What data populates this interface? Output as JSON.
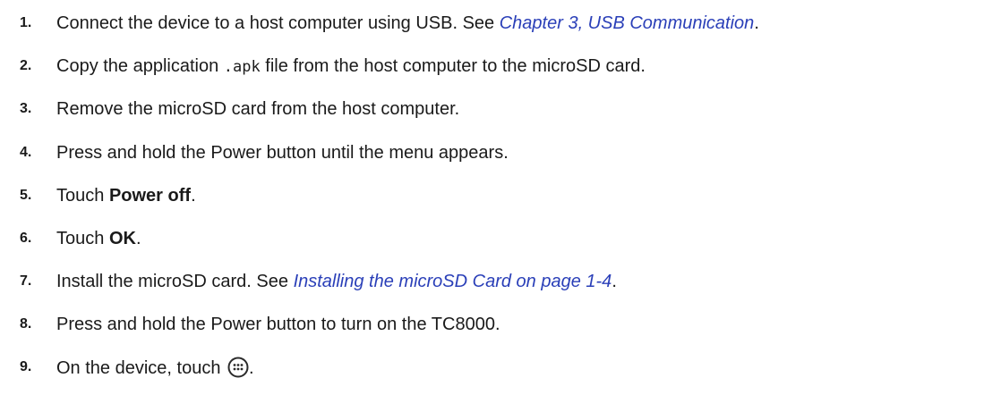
{
  "steps": [
    {
      "number": "1.",
      "text_before": "Connect the device to a host computer using USB. See ",
      "link": "Chapter 3, USB Communication",
      "text_after": "."
    },
    {
      "number": "2.",
      "text_before": "Copy the application ",
      "code": ".apk",
      "text_after": " file from the host computer to the microSD card."
    },
    {
      "number": "3.",
      "text": "Remove the microSD card from the host computer."
    },
    {
      "number": "4.",
      "text": "Press and hold the Power button until the menu appears."
    },
    {
      "number": "5.",
      "text_before": "Touch ",
      "bold": "Power off",
      "text_after": "."
    },
    {
      "number": "6.",
      "text_before": "Touch ",
      "bold": "OK",
      "text_after": "."
    },
    {
      "number": "7.",
      "text_before": "Install the microSD card. See ",
      "link": "Installing the microSD Card on page 1-4",
      "text_after": "."
    },
    {
      "number": "8.",
      "text": "Press and hold the Power button to turn on the TC8000."
    },
    {
      "number": "9.",
      "text_before": "On the device, touch ",
      "icon": "apps-grid-icon",
      "text_after": "."
    }
  ],
  "colors": {
    "link": "#2a3fb8",
    "text": "#1a1a1a"
  }
}
